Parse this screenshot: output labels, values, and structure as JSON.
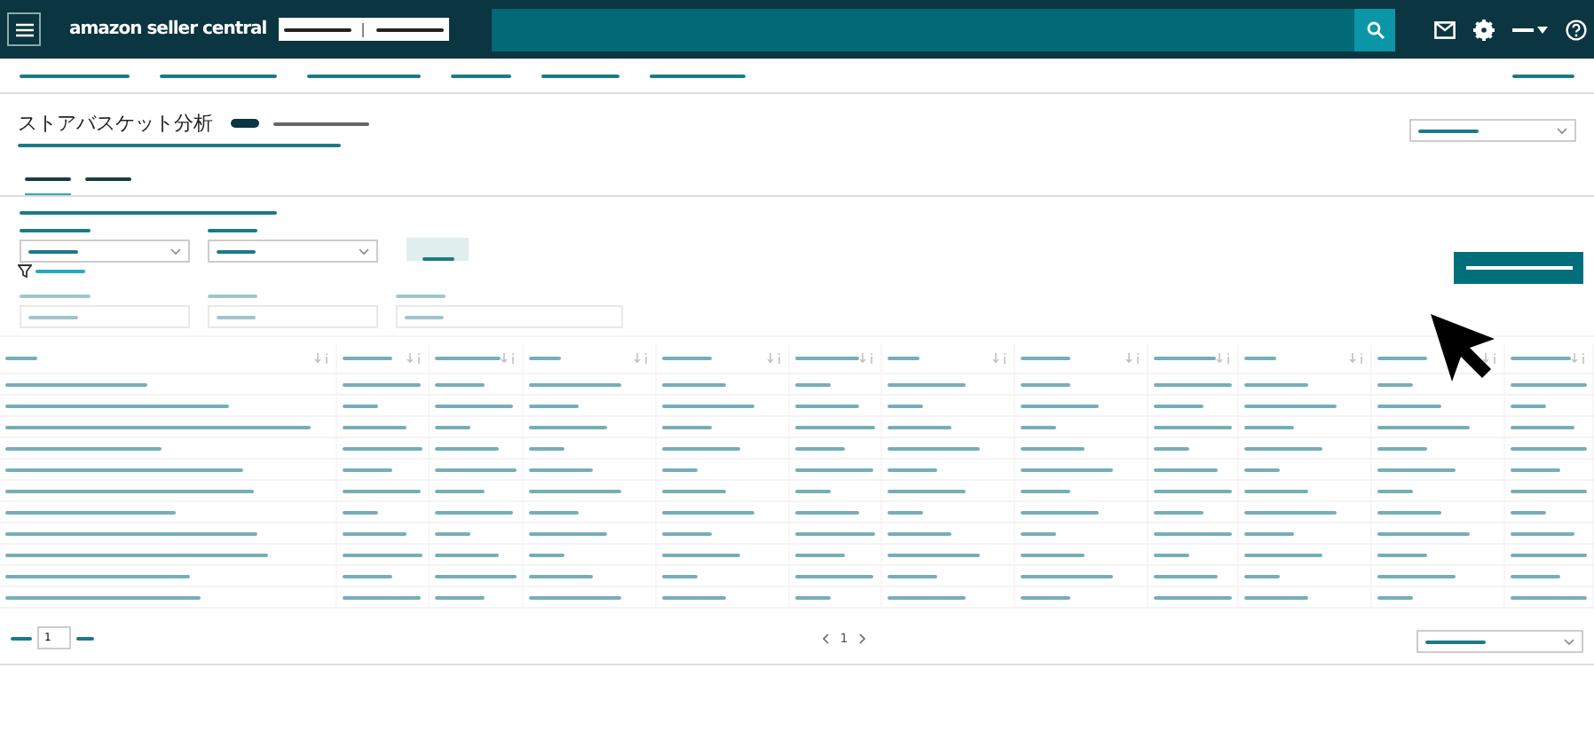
{
  "header": {
    "logo": "amazon seller central"
  },
  "page": {
    "title": "ストアバスケット分析"
  },
  "pagination": {
    "page_input": "1",
    "current_page": "1"
  }
}
